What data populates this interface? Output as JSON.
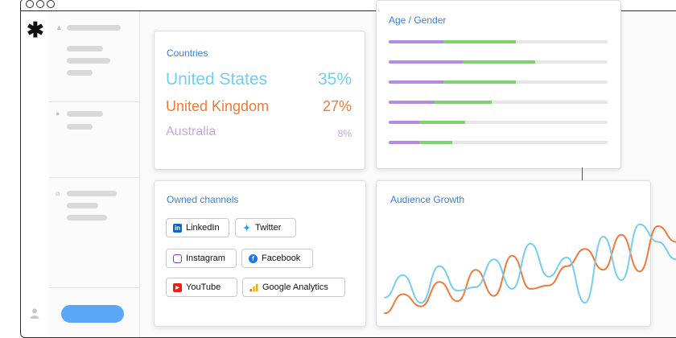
{
  "app": {
    "accent": "#3d7fd9",
    "sidebar_button_color": "#5aa8f5"
  },
  "countries": {
    "title": "Countries",
    "items": [
      {
        "name": "United States",
        "pct": "35%",
        "color": "#76cdef"
      },
      {
        "name": "United Kingdom",
        "pct": "27%",
        "color": "#f07a3a"
      },
      {
        "name": "Australia",
        "pct": "8%",
        "color": "#c6a7ec"
      }
    ]
  },
  "age_gender": {
    "title": "Age / Gender",
    "rows": [
      {
        "purple": 0.25,
        "green": 0.33
      },
      {
        "purple": 0.34,
        "green": 0.33
      },
      {
        "purple": 0.25,
        "green": 0.33
      },
      {
        "purple": 0.21,
        "green": 0.26
      },
      {
        "purple": 0.14,
        "green": 0.21
      },
      {
        "purple": 0.14,
        "green": 0.15
      }
    ],
    "colors": {
      "purple": "#b38be3",
      "green": "#7dd46f",
      "track": "#e6e6e6"
    }
  },
  "owned_channels": {
    "title": "Owned channels",
    "buttons": [
      {
        "label": "LinkedIn",
        "icon": "linkedin-icon"
      },
      {
        "label": "Twitter",
        "icon": "twitter-icon"
      },
      {
        "label": "Instagram",
        "icon": "instagram-icon"
      },
      {
        "label": "Facebook",
        "icon": "facebook-icon"
      },
      {
        "label": "YouTube",
        "icon": "youtube-icon"
      },
      {
        "label": "Google Analytics",
        "icon": "google-analytics-icon"
      }
    ]
  },
  "audience_growth": {
    "title": "Audience Growth",
    "series": [
      {
        "color": "#f07a3a",
        "values": [
          8,
          30,
          16,
          44,
          22,
          58,
          28,
          74,
          36,
          40,
          62,
          82,
          58,
          98,
          56,
          108,
          90
        ]
      },
      {
        "color": "#76cdef",
        "values": [
          26,
          52,
          20,
          62,
          34,
          38,
          70,
          36,
          88,
          50,
          72,
          20,
          96,
          46,
          110,
          90,
          70
        ]
      }
    ]
  }
}
